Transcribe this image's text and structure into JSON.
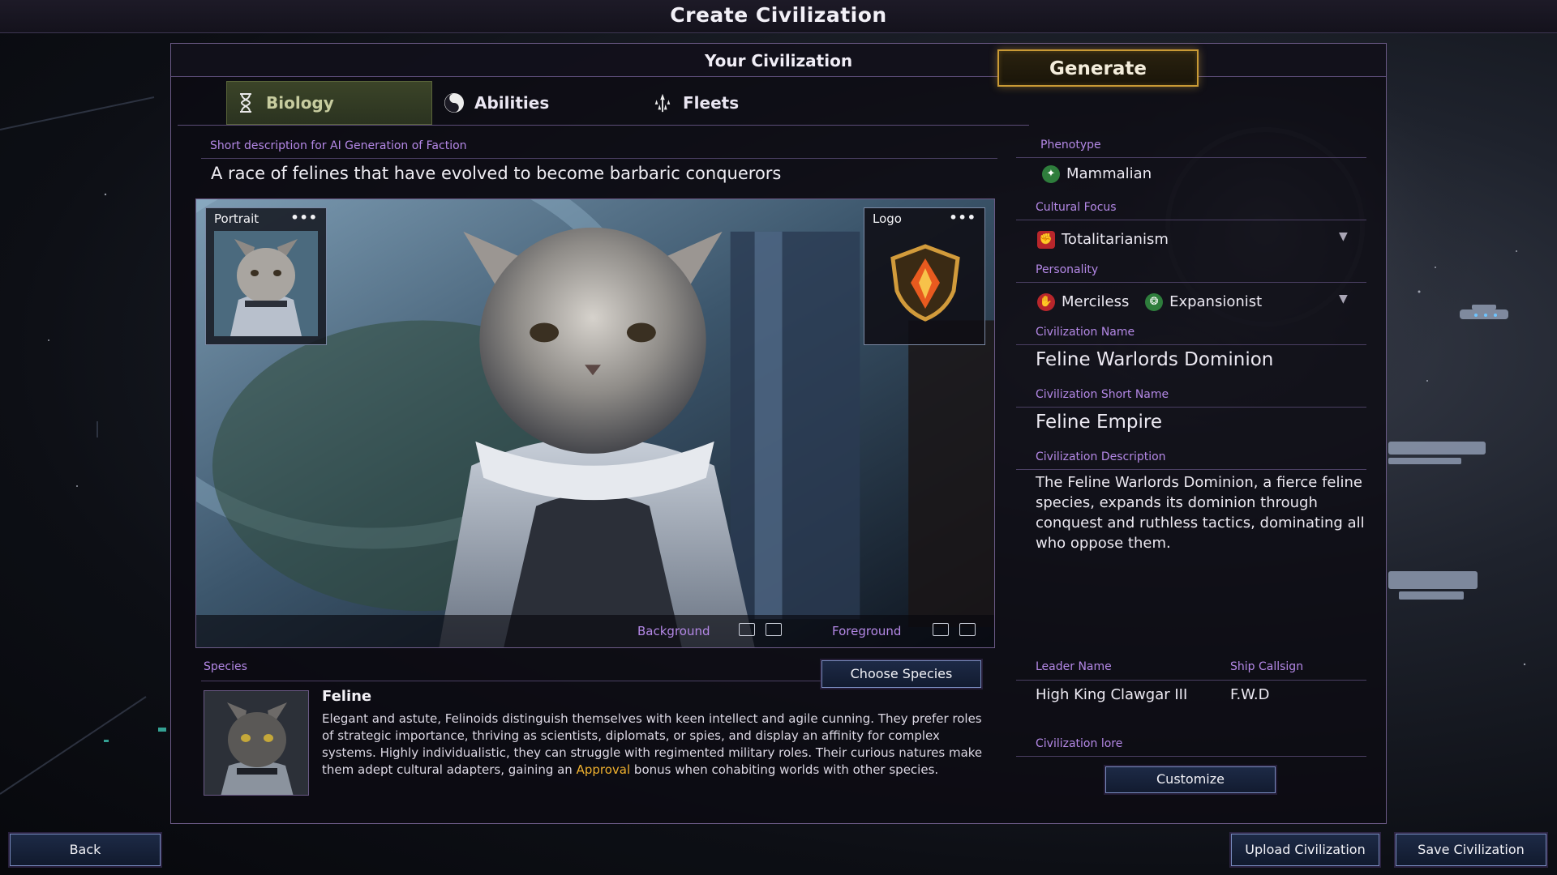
{
  "window": {
    "title": "Create Civilization"
  },
  "panel": {
    "title": "Your Civilization"
  },
  "tabs": [
    {
      "label": "Biology",
      "icon": "hourglass-icon",
      "active": true
    },
    {
      "label": "Abilities",
      "icon": "yin-yang-icon",
      "active": false
    },
    {
      "label": "Fleets",
      "icon": "fleet-ships-icon",
      "active": false
    }
  ],
  "generate": {
    "label": "Generate"
  },
  "short_description": {
    "label": "Short description for AI Generation of Faction",
    "value": "A race of felines that have evolved to become barbaric conquerors"
  },
  "art": {
    "portrait_label": "Portrait",
    "logo_label": "Logo",
    "menu_glyph": "•••",
    "background_label": "Background",
    "foreground_label": "Foreground"
  },
  "species": {
    "label": "Species",
    "choose_button": "Choose Species",
    "name": "Feline",
    "description_before": "Elegant and astute, Felinoids distinguish themselves with keen intellect and agile cunning. They prefer roles of strategic importance, thriving as scientists, diplomats, or spies, and display an affinity for complex systems. Highly individualistic, they can struggle with regimented military roles. Their curious natures make them adept cultural adapters, gaining an ",
    "description_highlight": "Approval",
    "description_after": " bonus when cohabiting worlds with other species."
  },
  "right_panel": {
    "phenotype_label": "Phenotype",
    "phenotype_value": "Mammalian",
    "cultural_focus_label": "Cultural Focus",
    "cultural_focus_value": "Totalitarianism",
    "personality_label": "Personality",
    "personality_values": [
      "Merciless",
      "Expansionist"
    ],
    "civ_name_label": "Civilization Name",
    "civ_name_value": "Feline Warlords Dominion",
    "civ_short_label": "Civilization Short Name",
    "civ_short_value": "Feline Empire",
    "civ_desc_label": "Civilization Description",
    "civ_desc_value": "The Feline Warlords Dominion, a fierce feline species, expands its dominion through conquest and ruthless tactics, dominating all who oppose them.",
    "leader_label": "Leader Name",
    "leader_value": "High King Clawgar III",
    "callsign_label": "Ship Callsign",
    "callsign_value": "F.W.D",
    "lore_label": "Civilization lore",
    "customize_button": "Customize"
  },
  "bottom": {
    "back": "Back",
    "upload": "Upload Civilization",
    "save": "Save Civilization"
  },
  "colors": {
    "accent_purple": "#b488e6",
    "generate_gold": "#c99a35",
    "approval_orange": "#f0b12e",
    "border_purple": "#6b5a86"
  }
}
